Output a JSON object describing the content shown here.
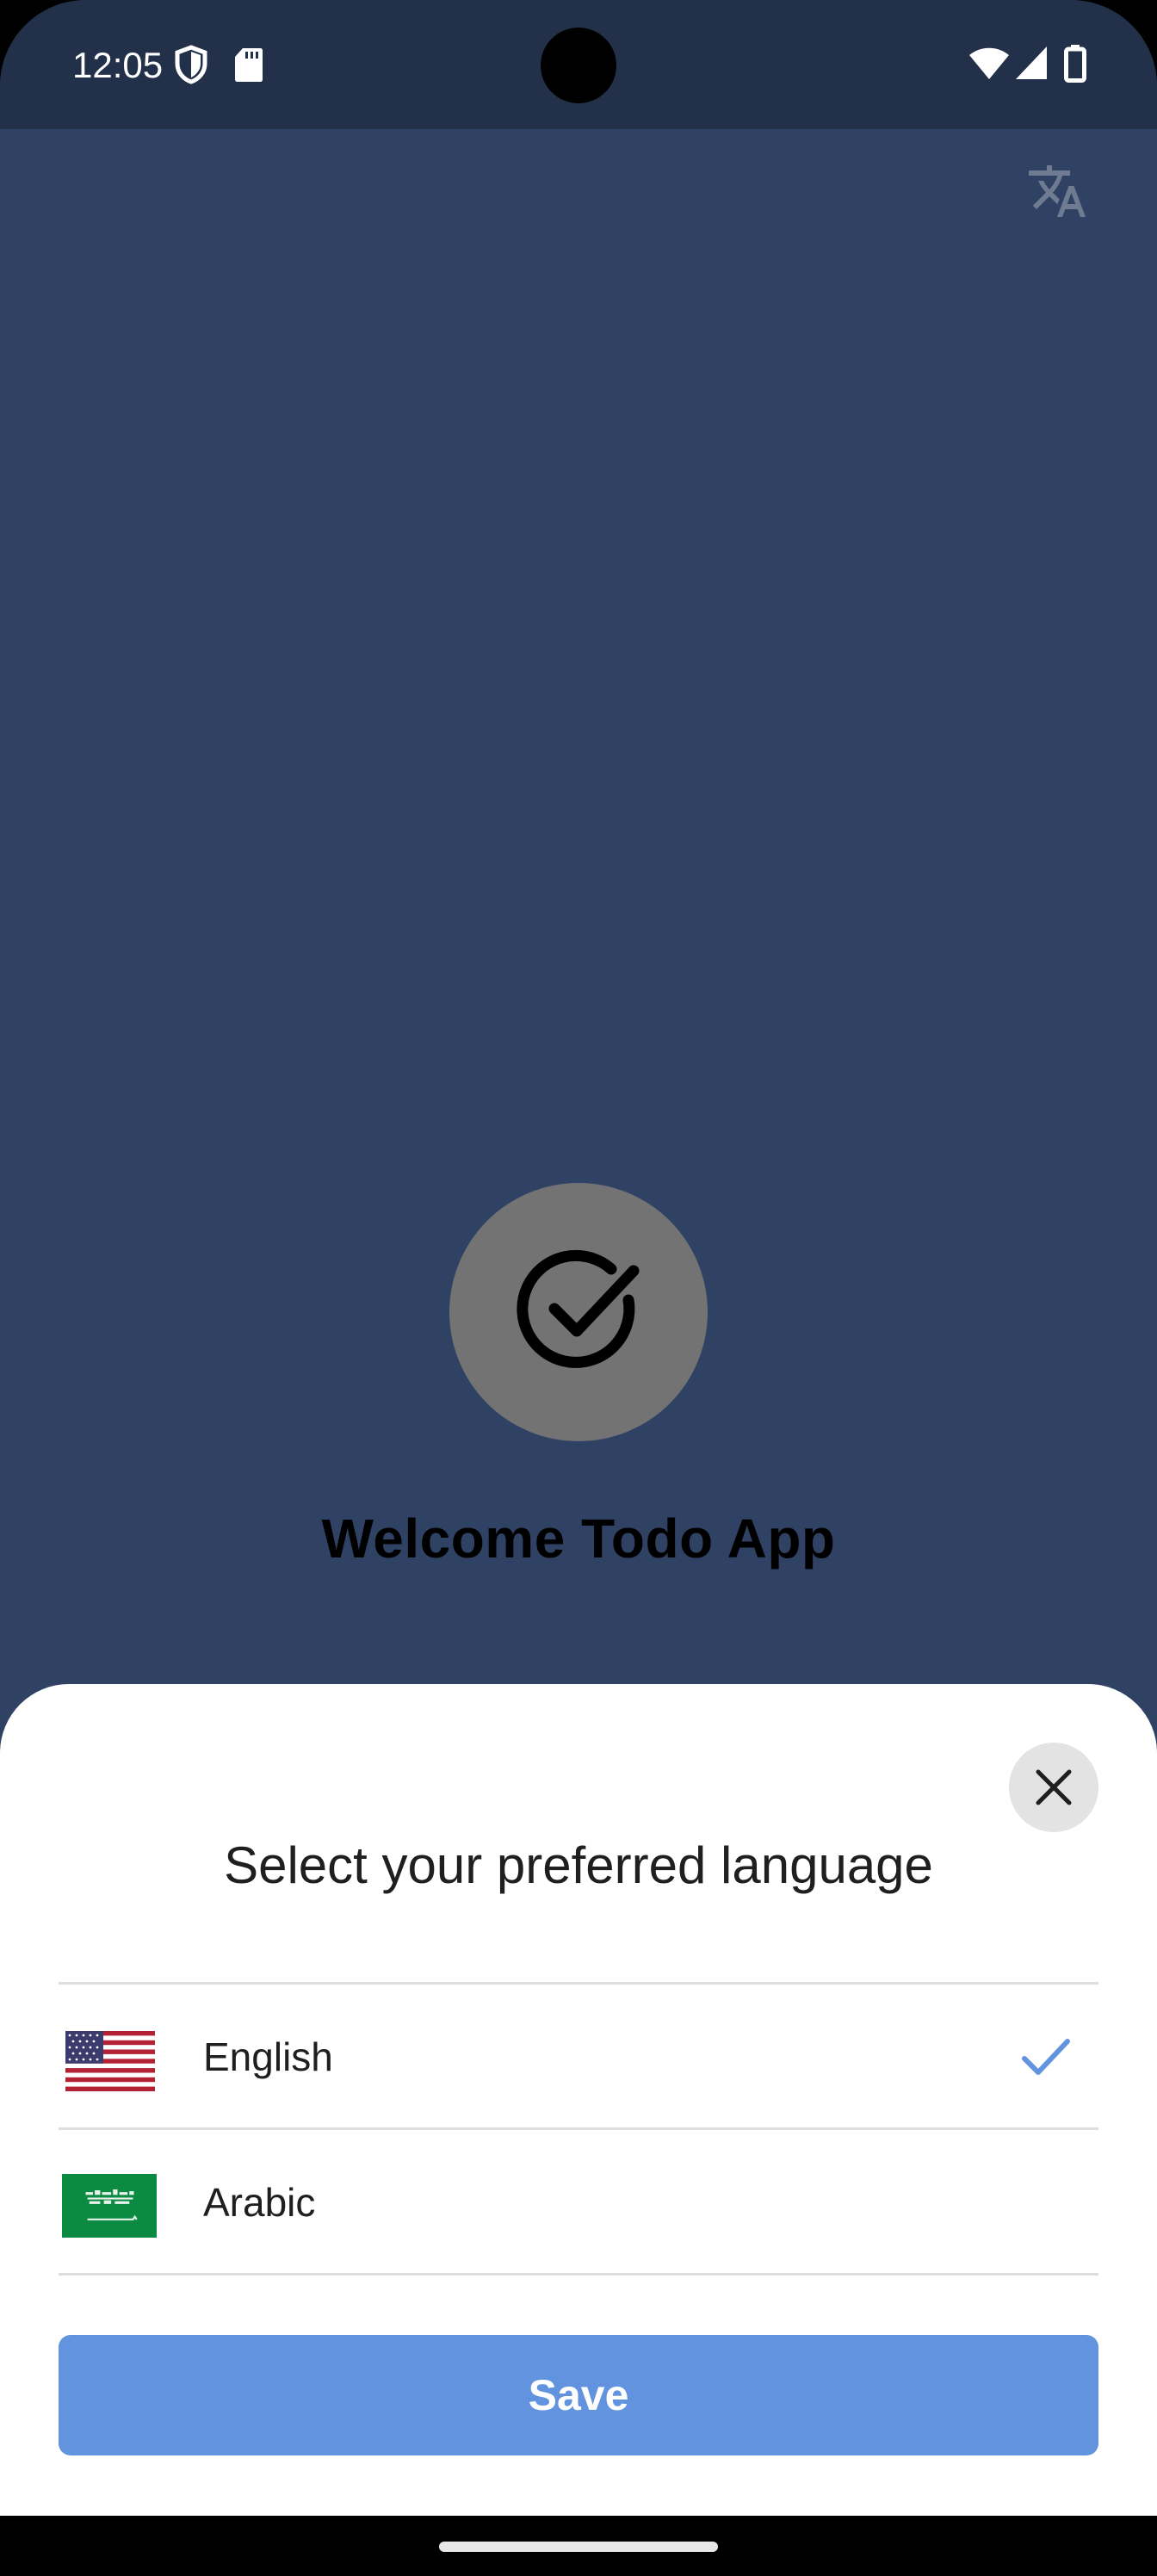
{
  "status_bar": {
    "time": "12:05",
    "icons": [
      "shield-icon",
      "sd-card-icon",
      "wifi-icon",
      "signal-icon",
      "battery-icon"
    ]
  },
  "header": {
    "translate_icon": "translate-icon"
  },
  "welcome": {
    "logo_icon": "check-circle-icon",
    "title": "Welcome Todo App"
  },
  "language_sheet": {
    "title": "Select your preferred language",
    "close_icon": "close-icon",
    "options": [
      {
        "label": "English",
        "flag": "us-flag-icon",
        "selected": true
      },
      {
        "label": "Arabic",
        "flag": "saudi-flag-icon",
        "selected": false
      }
    ],
    "save_label": "Save"
  },
  "colors": {
    "background": "#2f4264",
    "status_bar": "#223049",
    "logo_circle": "#737373",
    "accent": "#6193de",
    "check": "#6193de"
  }
}
